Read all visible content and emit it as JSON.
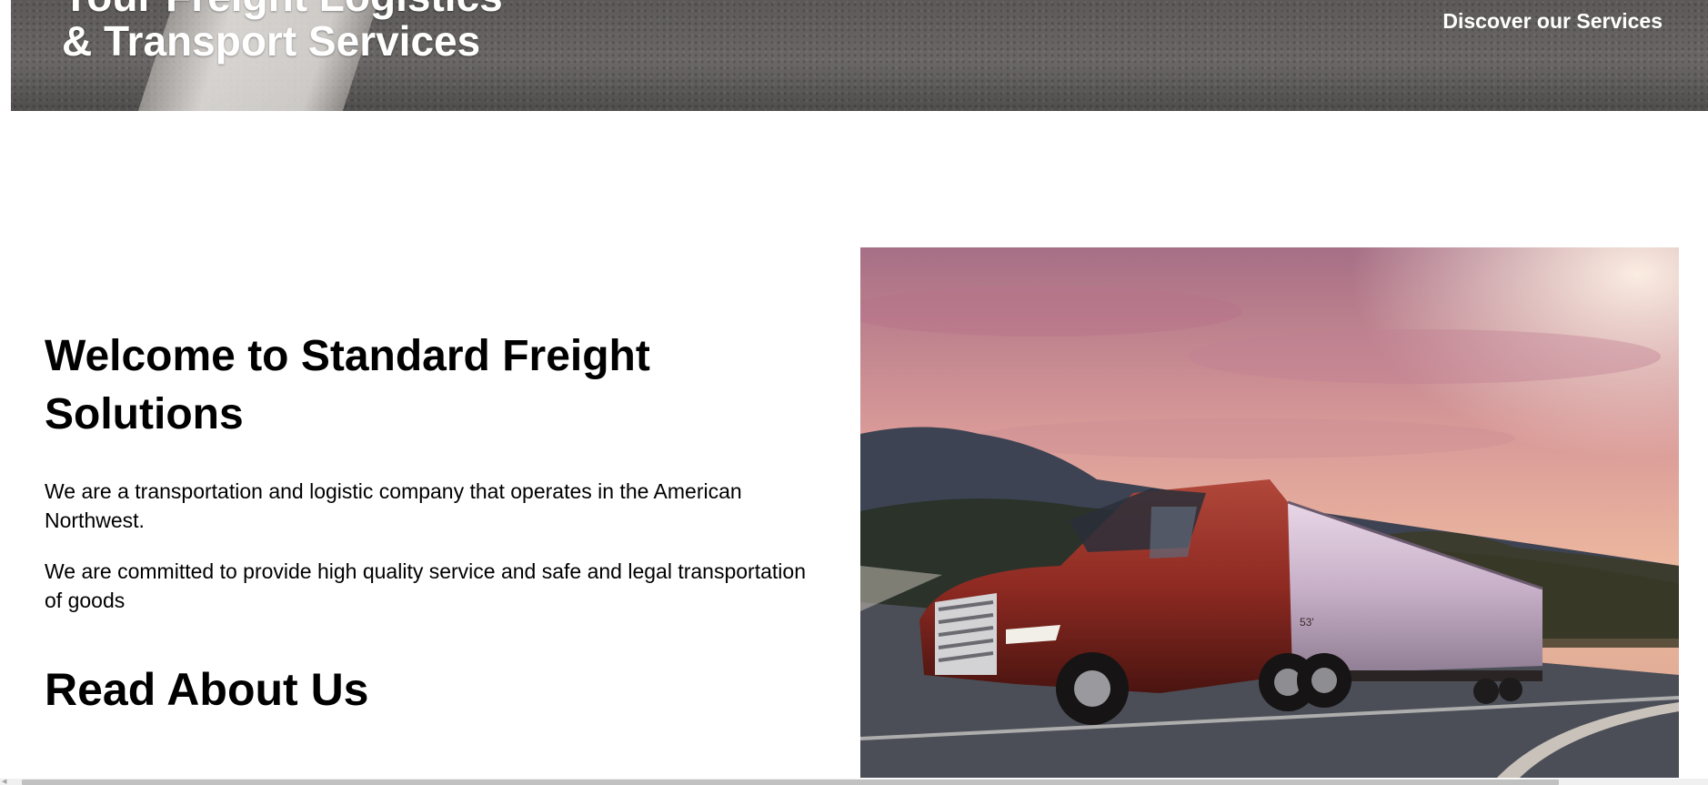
{
  "hero": {
    "title_line1": "Your Freight Logistics",
    "title_line2": "& Transport Services",
    "discover_link": "Discover our Services"
  },
  "welcome": {
    "title": "Welcome to Standard Freight Solutions",
    "paragraph1": "We are a transportation and logistic company that operates in the American Northwest.",
    "paragraph2": "We are committed to provide high quality service and safe and legal transportation of goods",
    "about_heading": "Read About Us"
  },
  "photo": {
    "subject": "red semi-truck with trailer on highway at sunset",
    "trailer_label": "53'"
  },
  "colors": {
    "hero_bg": "#5c5958",
    "truck_red": "#8e2a22",
    "sky_pink": "#d79a95"
  }
}
